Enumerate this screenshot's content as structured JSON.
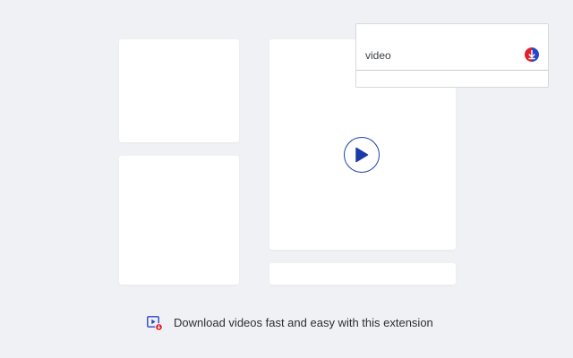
{
  "popup": {
    "label": "video",
    "icon": "download-circle-icon",
    "icon_colors": [
      "#e0202a",
      "#2746c7"
    ]
  },
  "player": {
    "play_icon": "play-icon",
    "accent": "#1f3fae"
  },
  "footer": {
    "icon": "video-download-icon",
    "text": "Download videos fast and easy with this extension"
  },
  "colors": {
    "background": "#f0f1f4",
    "card": "#ffffff",
    "accent_red": "#e0202a",
    "accent_blue": "#1f3fae"
  }
}
